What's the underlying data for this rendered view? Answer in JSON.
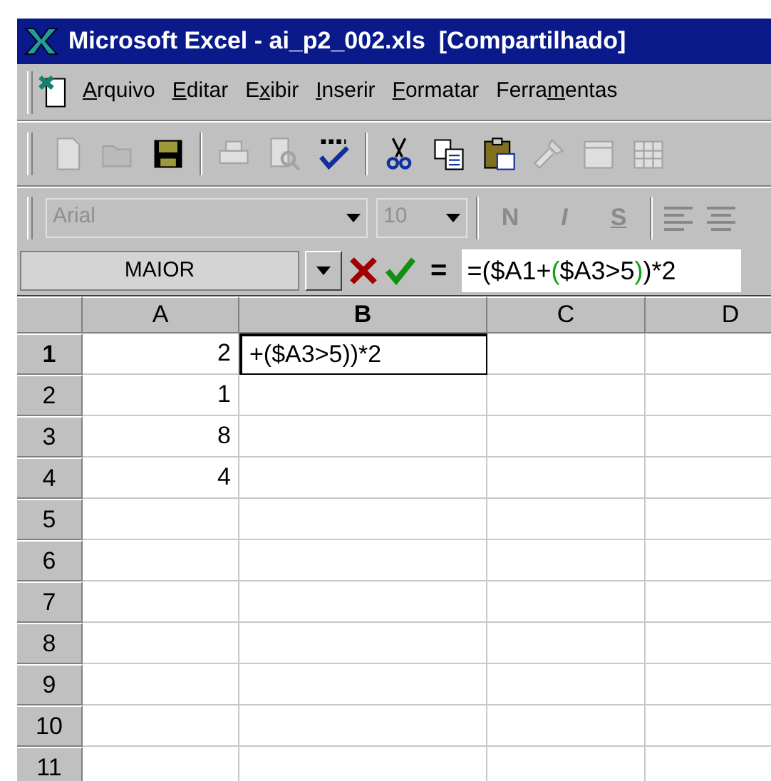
{
  "window": {
    "title": "Microsoft Excel - ai_p2_002.xls  [Compartilhado]"
  },
  "menu": [
    {
      "key": "A",
      "after": "rquivo"
    },
    {
      "key": "E",
      "after": "ditar"
    },
    {
      "before": "E",
      "key": "x",
      "after": "ibir"
    },
    {
      "key": "I",
      "after": "nserir"
    },
    {
      "key": "F",
      "after": "ormatar"
    },
    {
      "before": "Ferra",
      "key": "m",
      "after": "entas"
    }
  ],
  "toolbar": [
    {
      "kind": "new",
      "disabled": true
    },
    {
      "kind": "open",
      "disabled": true
    },
    {
      "kind": "save",
      "disabled": false
    },
    {
      "kind": "separator"
    },
    {
      "kind": "print",
      "disabled": true
    },
    {
      "kind": "preview",
      "disabled": true
    },
    {
      "kind": "spelling",
      "disabled": false
    },
    {
      "kind": "separator"
    },
    {
      "kind": "cut",
      "disabled": false
    },
    {
      "kind": "copy",
      "disabled": false
    },
    {
      "kind": "paste",
      "disabled": false
    },
    {
      "kind": "brush",
      "disabled": true
    },
    {
      "kind": "calendar",
      "disabled": true
    },
    {
      "kind": "grid",
      "disabled": true
    }
  ],
  "format_toolbar": {
    "font": {
      "value": "Arial",
      "disabled": true
    },
    "size": {
      "value": "10",
      "disabled": true
    },
    "buttons": [
      {
        "label": "N",
        "kind": "bold",
        "disabled": true
      },
      {
        "label": "I",
        "kind": "italic",
        "disabled": true
      },
      {
        "label": "S",
        "kind": "underline",
        "disabled": true
      }
    ]
  },
  "formula_bar": {
    "name_box": "MAIOR",
    "equals": "=",
    "formula": [
      {
        "text": "=($A1+",
        "highlighted": false
      },
      {
        "text": "(",
        "highlighted": true
      },
      {
        "text": "$A3>5",
        "highlighted": false
      },
      {
        "text": ")",
        "highlighted": true
      },
      {
        "text": ")*2",
        "highlighted": false
      }
    ]
  },
  "sheet": {
    "columns": [
      {
        "label": "A",
        "selected": false
      },
      {
        "label": "B",
        "selected": true
      },
      {
        "label": "C",
        "selected": false
      },
      {
        "label": "D",
        "selected": false
      }
    ],
    "rows": [
      {
        "label": "1",
        "selected": true,
        "cells": [
          {
            "text": "2",
            "selected": false
          },
          {
            "text": "+($A3>5))*2",
            "selected": true
          }
        ]
      },
      {
        "label": "2",
        "selected": false,
        "cells": [
          {
            "text": "1",
            "selected": false
          }
        ]
      },
      {
        "label": "3",
        "selected": false,
        "cells": [
          {
            "text": "8",
            "selected": false
          }
        ]
      },
      {
        "label": "4",
        "selected": false,
        "cells": [
          {
            "text": "4",
            "selected": false
          }
        ]
      },
      {
        "label": "5",
        "selected": false
      },
      {
        "label": "6",
        "selected": false
      },
      {
        "label": "7",
        "selected": false
      },
      {
        "label": "8",
        "selected": false
      },
      {
        "label": "9",
        "selected": false
      },
      {
        "label": "10",
        "selected": false
      },
      {
        "label": "11",
        "selected": false
      }
    ]
  }
}
